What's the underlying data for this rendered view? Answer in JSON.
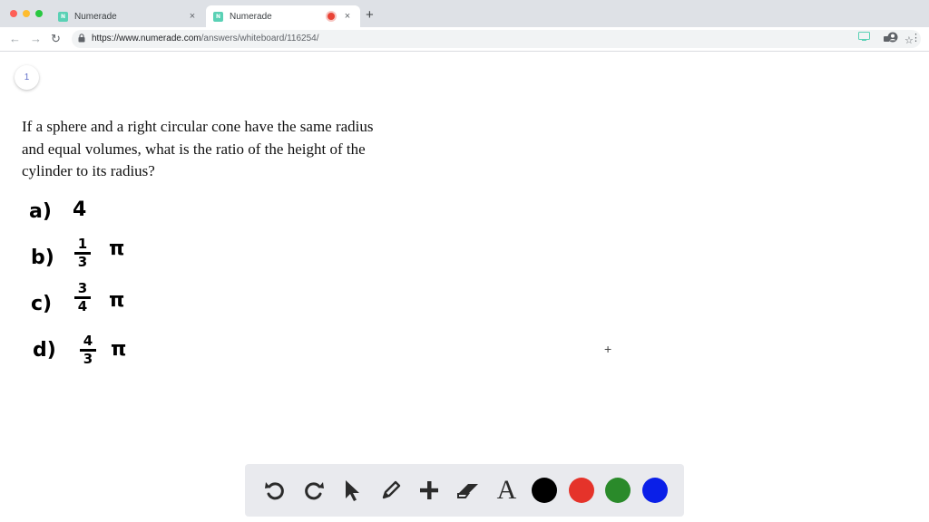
{
  "browser": {
    "tabs": [
      {
        "title": "Numerade",
        "favicon": "N",
        "close": "×"
      },
      {
        "title": "Numerade",
        "favicon": "N",
        "close": "×",
        "recording": true
      }
    ],
    "new_tab": "+",
    "url_host": "https://www.numerade.com",
    "url_path": "/answers/whiteboard/116254/",
    "icons": {
      "back": "←",
      "forward": "→",
      "reload": "↻",
      "lock": "🔒",
      "camera": "■",
      "star": "☆",
      "cast": "▭",
      "account": "◉",
      "menu": "⋮"
    }
  },
  "whiteboard": {
    "page_number": "1",
    "question": "If a sphere and a right circular cone have the same radius and equal volumes, what is the ratio of the height of the cylinder to its radius?",
    "options": [
      {
        "letter": "a)",
        "value": "4"
      },
      {
        "letter": "b)",
        "numerator": "1",
        "denominator": "3",
        "suffix": "π"
      },
      {
        "letter": "c)",
        "numerator": "3",
        "denominator": "4",
        "suffix": "π"
      },
      {
        "letter": "d)",
        "numerator": "4",
        "denominator": "3",
        "suffix": "π"
      }
    ],
    "cursor_glyph": "+"
  },
  "toolbar": {
    "undo": "↶",
    "redo": "↷",
    "pointer": "➤",
    "pen": "✎",
    "add": "+",
    "eraser": "▱",
    "text": "A",
    "colors": [
      "#000000",
      "#e5332a",
      "#2a8a2a",
      "#0a1fe8"
    ]
  }
}
